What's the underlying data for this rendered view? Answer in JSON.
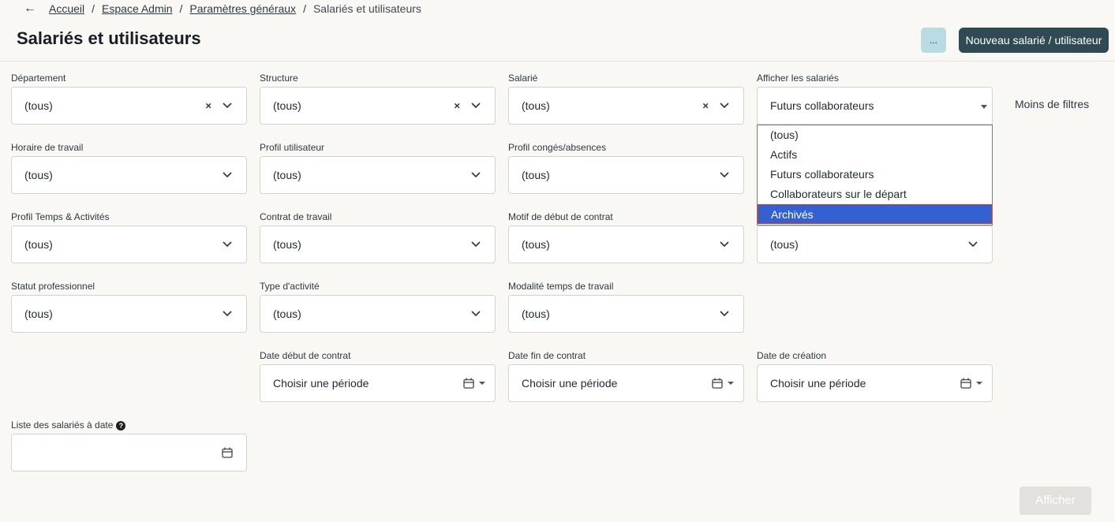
{
  "breadcrumb": {
    "back_icon": "arrow-left-icon",
    "items": [
      "Accueil",
      "Espace Admin",
      "Paramètres généraux"
    ],
    "separator": "/",
    "current": "Salariés et utilisateurs"
  },
  "header": {
    "title": "Salariés et utilisateurs",
    "more_label": "...",
    "new_label": "Nouveau salarié / utilisateur"
  },
  "filters": {
    "departement": {
      "label": "Département",
      "value": "(tous)",
      "clear": "×"
    },
    "structure": {
      "label": "Structure",
      "value": "(tous)",
      "clear": "×"
    },
    "salarie": {
      "label": "Salarié",
      "value": "(tous)",
      "clear": "×"
    },
    "afficher": {
      "label": "Afficher les salariés",
      "value": "Futurs collaborateurs"
    },
    "horaire": {
      "label": "Horaire de travail",
      "value": "(tous)"
    },
    "profil_utilisateur": {
      "label": "Profil utilisateur",
      "value": "(tous)"
    },
    "profil_conges": {
      "label": "Profil congés/absences",
      "value": "(tous)"
    },
    "profil_temps": {
      "label": "Profil Temps & Activités",
      "value": "(tous)"
    },
    "contrat": {
      "label": "Contrat de travail",
      "value": "(tous)"
    },
    "motif": {
      "label": "Motif de début de contrat",
      "value": "(tous)"
    },
    "hidden_col4": {
      "value": "(tous)"
    },
    "statut": {
      "label": "Statut professionnel",
      "value": "(tous)"
    },
    "type_activite": {
      "label": "Type d'activité",
      "value": "(tous)"
    },
    "modalite": {
      "label": "Modalité temps de travail",
      "value": "(tous)"
    },
    "date_debut": {
      "label": "Date début de contrat",
      "value": "Choisir une période"
    },
    "date_fin": {
      "label": "Date fin de contrat",
      "value": "Choisir une période"
    },
    "date_creation": {
      "label": "Date de création",
      "value": "Choisir une période"
    },
    "liste_date": {
      "label": "Liste des salariés à date",
      "help": "?"
    }
  },
  "dropdown": {
    "options": [
      "(tous)",
      "Actifs",
      "Futurs collaborateurs",
      "Collaborateurs sur le départ",
      "Archivés"
    ],
    "highlighted": "Archivés"
  },
  "less_filters_label": "Moins de filtres",
  "show_button_label": "Afficher",
  "colors": {
    "primary_dark": "#2f4a52",
    "secondary_light": "#b9dbe3",
    "highlight": "#3461d1",
    "background": "#faf8f5"
  }
}
